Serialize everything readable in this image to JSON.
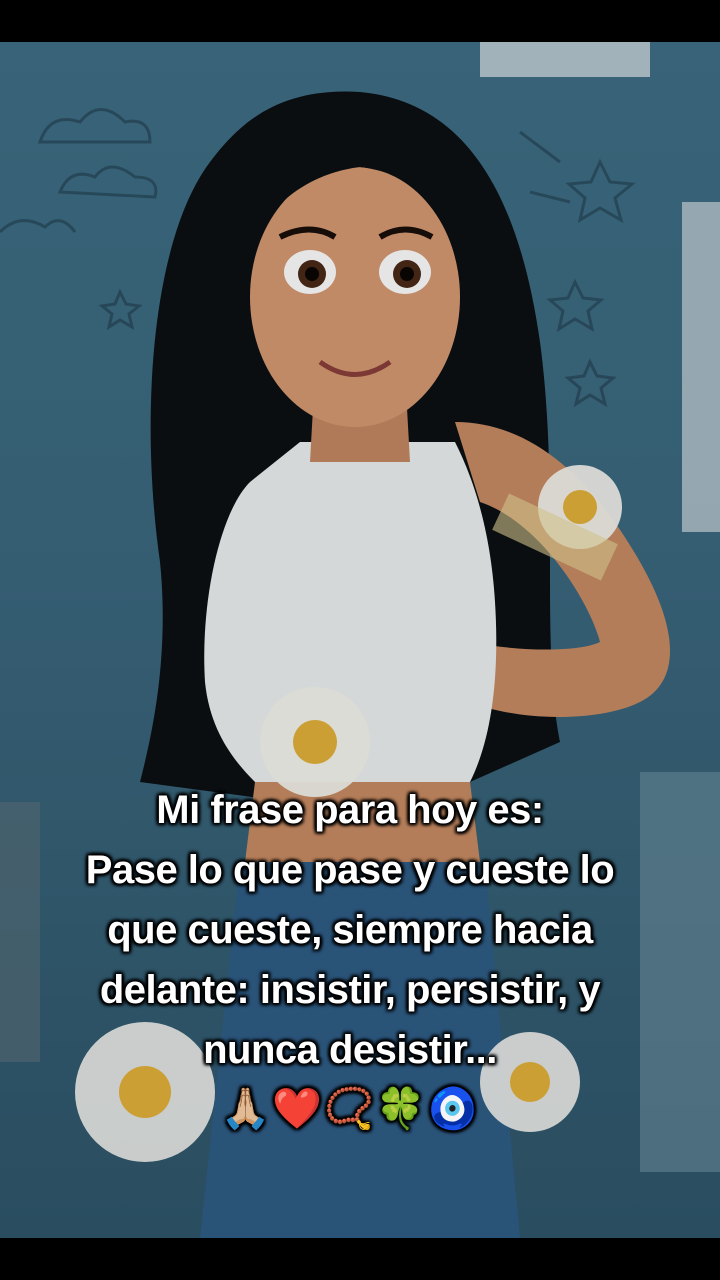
{
  "caption": {
    "line1": "Mi frase para hoy es:",
    "line2": "Pase lo que pase y cueste lo",
    "line3": "que cueste, siempre hacia",
    "line4": "delante: insistir, persistir, y",
    "line5": "nunca desistir...",
    "emojis": "🙏🏼❤️📿🍀🧿"
  },
  "colors": {
    "background_wall": "#3f6f86",
    "caption_text": "#ffffff",
    "letterbox": "#000000"
  }
}
